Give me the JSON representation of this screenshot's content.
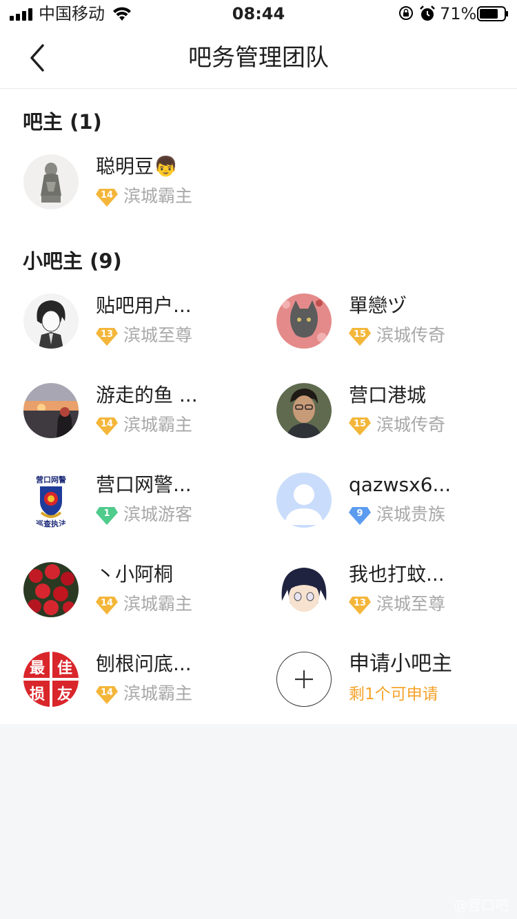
{
  "status_bar": {
    "carrier": "中国移动",
    "time": "08:44",
    "battery": "71%"
  },
  "nav": {
    "title": "吧务管理团队",
    "back_icon": "chevron-left-icon"
  },
  "owner_section": {
    "title": "吧主 (1)",
    "members": [
      {
        "name": "聪明豆👦",
        "level": "14",
        "level_color": "#f4b63a",
        "title": "滨城霸主",
        "avatar": "statue"
      }
    ]
  },
  "assistant_section": {
    "title": "小吧主 (9)",
    "members": [
      {
        "name": "贴吧用户...",
        "level": "13",
        "level_color": "#f4b63a",
        "title": "滨城至尊",
        "avatar": "anime-boy"
      },
      {
        "name": "單戀ヅ",
        "level": "15",
        "level_color": "#f4b63a",
        "title": "滨城传奇",
        "avatar": "cat"
      },
      {
        "name": "游走的鱼 ...",
        "level": "14",
        "level_color": "#f4b63a",
        "title": "滨城霸主",
        "avatar": "sunset"
      },
      {
        "name": "营口港城",
        "level": "15",
        "level_color": "#f4b63a",
        "title": "滨城传奇",
        "avatar": "man"
      },
      {
        "name": "营口网警...",
        "level": "1",
        "level_color": "#4fcb8c",
        "title": "滨城游客",
        "avatar": "police"
      },
      {
        "name": "qazwsx6...",
        "level": "9",
        "level_color": "#5b9cf0",
        "title": "滨城贵族",
        "avatar": "default"
      },
      {
        "name": "丶小阿桐",
        "level": "14",
        "level_color": "#f4b63a",
        "title": "滨城霸主",
        "avatar": "roses"
      },
      {
        "name": "我也打蚊...",
        "level": "13",
        "level_color": "#f4b63a",
        "title": "滨城至尊",
        "avatar": "anime-girl"
      },
      {
        "name": "刨根问底...",
        "level": "14",
        "level_color": "#f4b63a",
        "title": "滨城霸主",
        "avatar": "text-logo"
      }
    ],
    "apply": {
      "label": "申请小吧主",
      "sub": "剩1个可申请",
      "icon": "plus-icon"
    }
  },
  "avatar_text": {
    "police_top": "营口网警",
    "police_bottom": "巡查执法",
    "logo_chars": [
      "最",
      "佳",
      "损",
      "友"
    ]
  },
  "watermark": "@营口吧"
}
